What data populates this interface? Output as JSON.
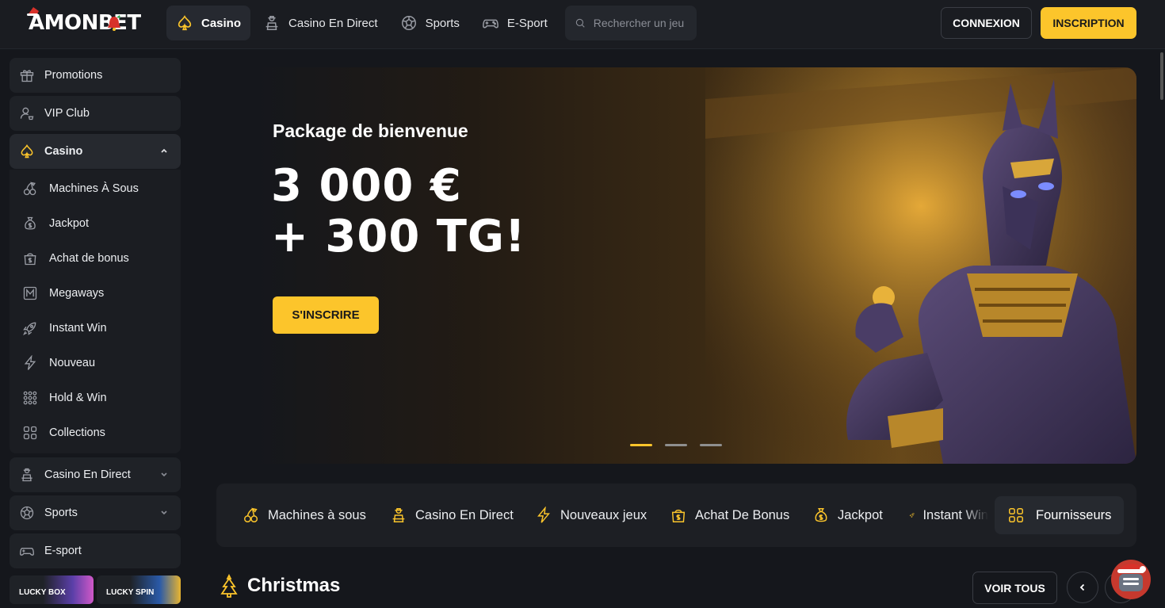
{
  "brand": {
    "logo_text": "AMONBET",
    "accent": "#fcc52b",
    "bg": "#15171c"
  },
  "header": {
    "nav": [
      {
        "label": "Casino",
        "icon": "spade-icon",
        "active": true
      },
      {
        "label": "Casino En Direct",
        "icon": "dealer-icon"
      },
      {
        "label": "Sports",
        "icon": "soccer-ball-icon"
      },
      {
        "label": "E-Sport",
        "icon": "gamepad-icon"
      }
    ],
    "search_placeholder": "Rechercher un jeu",
    "login_label": "CONNEXION",
    "register_label": "INSCRIPTION"
  },
  "sidebar": {
    "top_items": [
      {
        "label": "Promotions",
        "icon": "gift-icon"
      },
      {
        "label": "VIP Club",
        "icon": "vip-user-icon"
      }
    ],
    "casino": {
      "label": "Casino",
      "icon": "spade-icon",
      "expanded": true,
      "children": [
        {
          "label": "Machines À Sous",
          "icon": "cherries-icon"
        },
        {
          "label": "Jackpot",
          "icon": "money-bag-icon"
        },
        {
          "label": "Achat de bonus",
          "icon": "bonus-bag-icon"
        },
        {
          "label": "Megaways",
          "icon": "megaways-icon"
        },
        {
          "label": "Instant Win",
          "icon": "rocket-icon"
        },
        {
          "label": "Nouveau",
          "icon": "lightning-icon"
        },
        {
          "label": "Hold & Win",
          "icon": "hold-win-icon"
        },
        {
          "label": "Collections",
          "icon": "grid-icon"
        }
      ]
    },
    "bottom_items": [
      {
        "label": "Casino En Direct",
        "icon": "dealer-icon",
        "expandable": true
      },
      {
        "label": "Sports",
        "icon": "soccer-ball-icon",
        "expandable": true
      },
      {
        "label": "E-sport",
        "icon": "gamepad-icon"
      }
    ],
    "tiles": [
      {
        "label": "LUCKY BOX"
      },
      {
        "label": "LUCKY SPIN"
      }
    ]
  },
  "hero": {
    "title": "Package de bienvenue",
    "amount": "3 000 €\n+ 300 TG!",
    "cta_label": "S'INSCRIRE",
    "slides": 3,
    "active_slide": 1
  },
  "categories": [
    {
      "label": "Machines à sous",
      "icon": "cherries-icon"
    },
    {
      "label": "Casino En Direct",
      "icon": "dealer-icon"
    },
    {
      "label": "Nouveaux jeux",
      "icon": "lightning-icon"
    },
    {
      "label": "Achat De Bonus",
      "icon": "bonus-bag-icon"
    },
    {
      "label": "Jackpot",
      "icon": "money-bag-icon"
    },
    {
      "label": "Instant Win",
      "icon": "rocket-icon"
    }
  ],
  "providers_label": "Fournisseurs",
  "section": {
    "title": "Christmas",
    "icon": "christmas-tree-icon",
    "view_all_label": "VOIR TOUS"
  }
}
